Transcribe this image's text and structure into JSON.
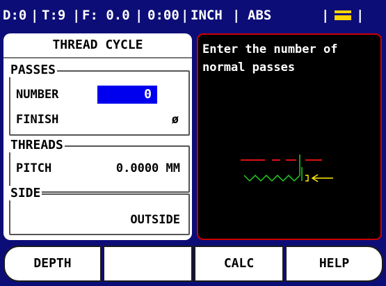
{
  "status_bar": {
    "d": "D:0",
    "t": "T:9",
    "f": "F: 0.0",
    "time": "0:00",
    "units": "INCH",
    "mode": "ABS",
    "icon": "tool-icon",
    "sep": "|"
  },
  "form": {
    "title": "THREAD CYCLE",
    "passes": {
      "legend": "PASSES",
      "number_label": "NUMBER",
      "number_value": "0",
      "finish_label": "FINISH",
      "finish_value": "ø"
    },
    "threads": {
      "legend": "THREADS",
      "pitch_label": "PITCH",
      "pitch_value": "0.0000 MM"
    },
    "side": {
      "legend": "SIDE",
      "value": "OUTSIDE"
    }
  },
  "help_panel": {
    "text": "Enter the number of normal passes"
  },
  "softkeys": [
    "DEPTH",
    "",
    "CALC",
    "HELP"
  ],
  "colors": {
    "background": "#0d0d78",
    "field_highlight": "#0000ee",
    "help_border": "#cc0000",
    "diagram_red": "#dd1111",
    "diagram_green": "#22cc22",
    "diagram_yellow": "#ffee00"
  }
}
